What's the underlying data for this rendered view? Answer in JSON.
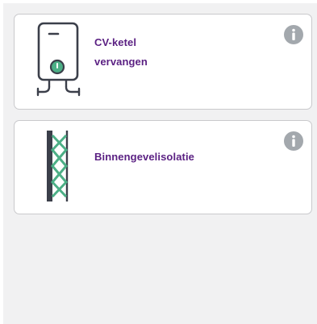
{
  "cards": [
    {
      "title": "CV-ketel vervangen",
      "illustration": "boiler-icon",
      "info_icon": "info-icon"
    },
    {
      "title": "Binnengevelisolatie",
      "illustration": "wall-insulation-icon",
      "info_icon": "info-icon"
    }
  ],
  "colors": {
    "title": "#5b2183",
    "accent_green": "#4caf86",
    "icon_dark": "#3b3f4a",
    "info_gray": "#a3a8ad",
    "panel_bg": "#f1f1f2",
    "card_border": "#c9c9cc"
  }
}
